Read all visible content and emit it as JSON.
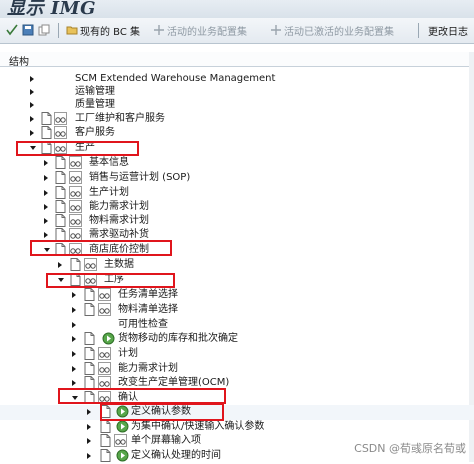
{
  "window": {
    "title": "显示 IMG"
  },
  "toolbar": {
    "btn1": "现有的 BC 集",
    "btn2": "活动的业务配置集",
    "btn3": "活动已激活的业务配置集",
    "btn4": "更改日志"
  },
  "panel": {
    "header": "结构"
  },
  "tree": {
    "rows": [
      {
        "label": "SCM Extended Warehouse Management"
      },
      {
        "label": "运输管理"
      },
      {
        "label": "质量管理"
      },
      {
        "label": "工厂维护和客户服务"
      },
      {
        "label": "客户服务"
      },
      {
        "label": "生产"
      },
      {
        "label": "基本信息"
      },
      {
        "label": "销售与运营计划 (SOP)"
      },
      {
        "label": "生产计划"
      },
      {
        "label": "能力需求计划"
      },
      {
        "label": "物料需求计划"
      },
      {
        "label": "需求驱动补货"
      },
      {
        "label": "商店底价控制"
      },
      {
        "label": "主数据"
      },
      {
        "label": "工序"
      },
      {
        "label": "任务清单选择"
      },
      {
        "label": "物料清单选择"
      },
      {
        "label": "可用性检查"
      },
      {
        "label": "货物移动的库存和批次确定"
      },
      {
        "label": "计划"
      },
      {
        "label": "能力需求计划"
      },
      {
        "label": "改变生产定单管理(OCM)"
      },
      {
        "label": "确认"
      },
      {
        "label": "定义确认参数"
      },
      {
        "label": "为集中确认/快速输入确认参数"
      },
      {
        "label": "单个屏幕输入项"
      },
      {
        "label": "定义确认处理的时间"
      }
    ]
  },
  "watermark": "CSDN @荀彧原名荀或",
  "colors": {
    "highlight": "#e0151c",
    "toolbar": "#e4eaf0"
  }
}
